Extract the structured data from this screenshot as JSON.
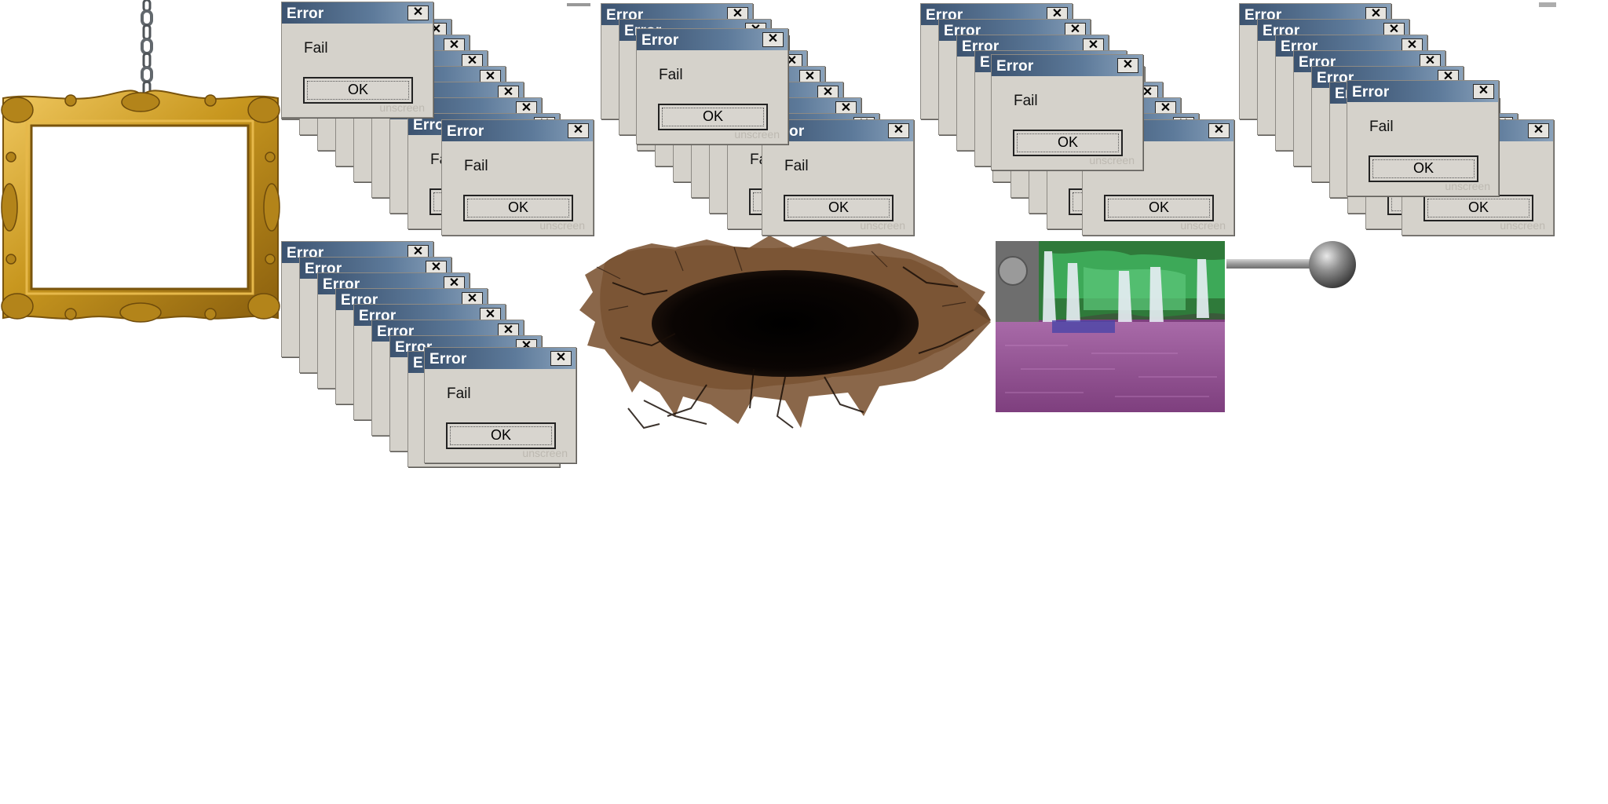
{
  "dialog": {
    "title": "Error",
    "message": "Fail",
    "ok_label": "OK",
    "close_label": "✕",
    "watermark": "unscreen"
  },
  "colors": {
    "titlebar_start": "#3c5370",
    "titlebar_end": "#8aa2bb",
    "dialog_face": "#d5d2cb",
    "frame_gold": "#c8971f",
    "hole_brown": "#6b4a2e",
    "water_magenta": "#b25aa8",
    "foliage_green": "#3fae5c"
  },
  "icons": [
    "chain-icon",
    "picture-frame",
    "cracked-hole",
    "waterfall-photo",
    "steel-ball-pin"
  ]
}
